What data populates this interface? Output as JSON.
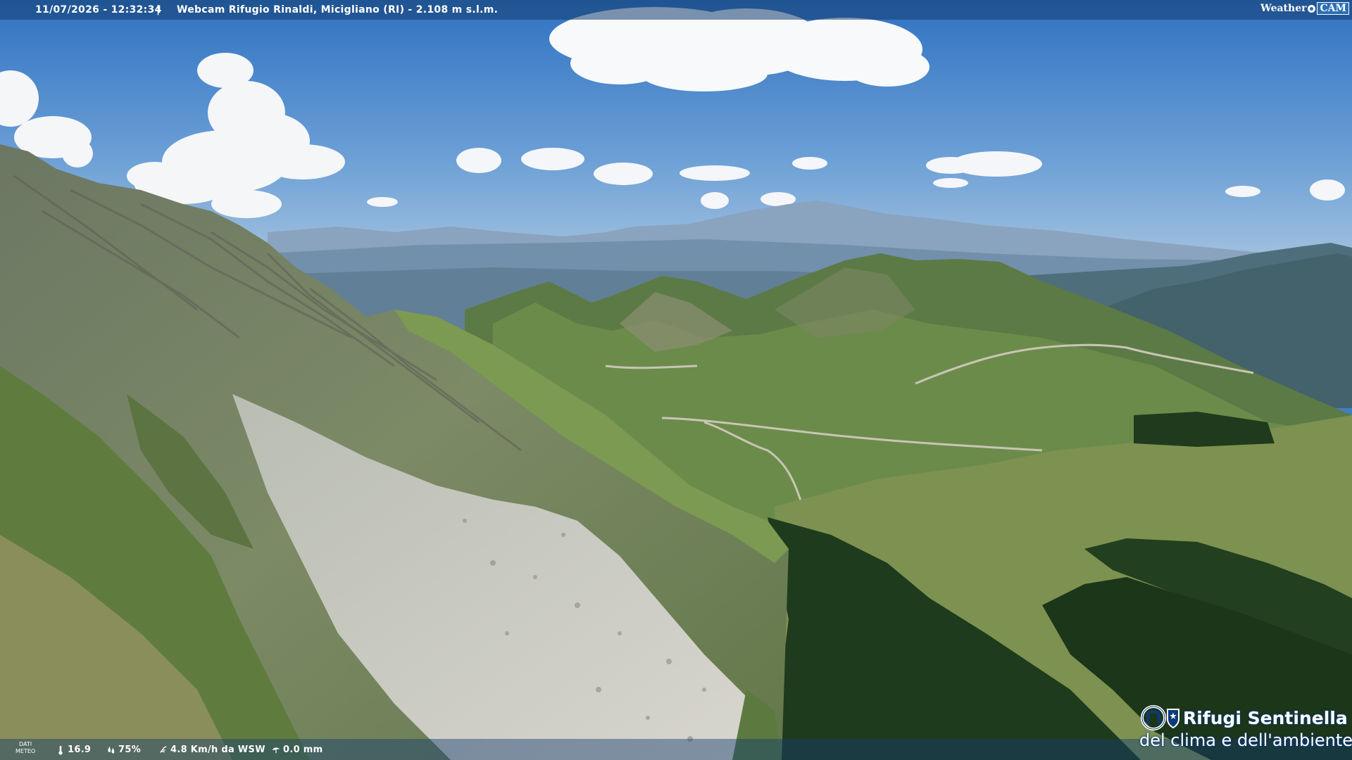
{
  "header": {
    "datetime": "11/07/2026 - 12:32:34",
    "separator": "|",
    "title": "Webcam Rifugio Rinaldi, Micigliano (RI) - 2.108 m s.l.m.",
    "brand_weather": "Weather",
    "brand_cam": "CAM"
  },
  "weather": {
    "label_line1": "DATI",
    "label_line2": "METEO",
    "temperature": "16.9",
    "humidity": "75%",
    "wind": "4.8 Km/h da WSW",
    "rain": "0.0 mm",
    "icons": [
      "thermometer-icon",
      "humidity-icon",
      "wind-icon",
      "rain-icon"
    ]
  },
  "logo": {
    "line1": "Rifugi Sentinella",
    "line2": "del clima e dell'ambiente"
  },
  "colors": {
    "sky_top": "#3577c4",
    "sky_horizon": "#a9c6e0",
    "meadow": "#6f8f48",
    "forest": "#1f3a1c",
    "scree": "#c9c8c0",
    "bar": "#1a4a82"
  }
}
